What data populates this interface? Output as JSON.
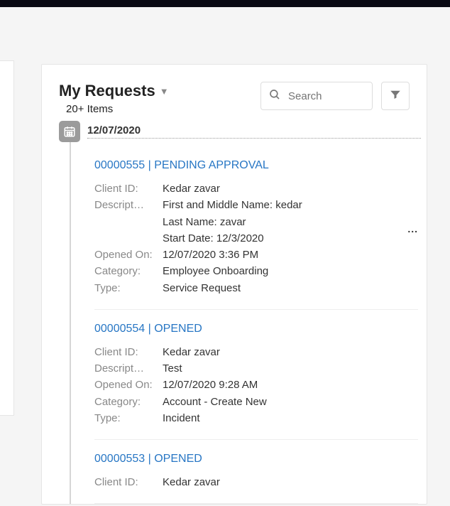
{
  "header": {
    "title": "My Requests",
    "subtitle": "20+ Items"
  },
  "search": {
    "placeholder": "Search",
    "value": ""
  },
  "labels": {
    "client_id": "Client ID:",
    "description": "Description:",
    "opened": "Opened On:",
    "category": "Category:",
    "type": "Type:",
    "sep": " | "
  },
  "groups": [
    {
      "date": "12/07/2020",
      "items": [
        {
          "number": "00000555",
          "status": "PENDING APPROVAL",
          "client_id": "Kedar zavar",
          "description": "First and Middle Name: kedar\nLast Name: zavar\nStart Date: 12/3/2020",
          "opened": "12/07/2020 3:36 PM",
          "category": "Employee Onboarding",
          "type": "Service Request",
          "has_more": true
        },
        {
          "number": "00000554",
          "status": "OPENED",
          "client_id": "Kedar zavar",
          "description": "Test",
          "opened": "12/07/2020 9:28 AM",
          "category": "Account - Create New",
          "type": "Incident",
          "has_more": false
        },
        {
          "number": "00000553",
          "status": "OPENED",
          "client_id": "Kedar zavar",
          "description": "",
          "opened": "",
          "category": "",
          "type": "",
          "has_more": false
        }
      ]
    }
  ]
}
